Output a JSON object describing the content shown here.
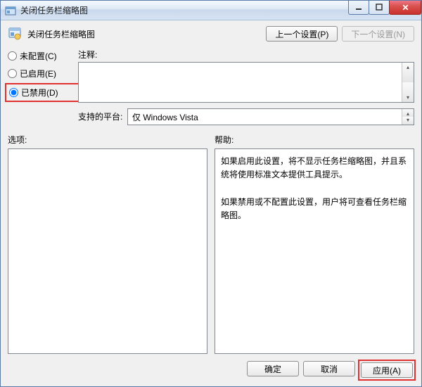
{
  "titlebar": {
    "title": "关闭任务栏缩略图"
  },
  "header": {
    "policy_title": "关闭任务栏缩略图",
    "prev_btn": "上一个设置(P)",
    "next_btn": "下一个设置(N)"
  },
  "radios": {
    "not_configured": "未配置(C)",
    "enabled": "已启用(E)",
    "disabled": "已禁用(D)",
    "selected": "disabled"
  },
  "labels": {
    "comment": "注释:",
    "supported": "支持的平台:",
    "options": "选项:",
    "help": "帮助:"
  },
  "platform": {
    "text": "仅 Windows Vista"
  },
  "help": {
    "p1": "如果启用此设置，将不显示任务栏缩略图，并且系统将使用标准文本提供工具提示。",
    "p2": "如果禁用或不配置此设置，用户将可查看任务栏缩略图。"
  },
  "footer": {
    "ok": "确定",
    "cancel": "取消",
    "apply": "应用(A)"
  }
}
